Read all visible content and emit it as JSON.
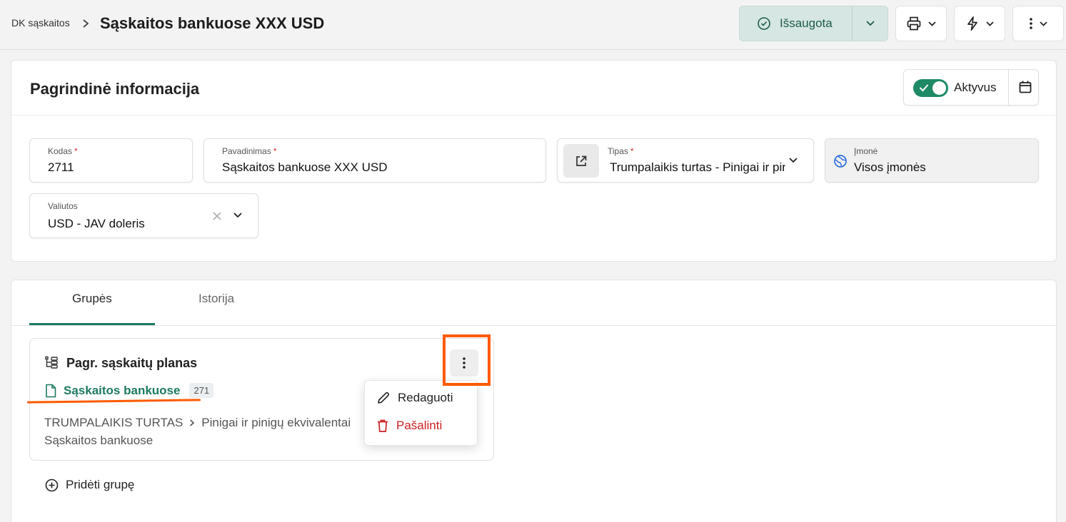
{
  "header": {
    "breadcrumb": "DK sąskaitos",
    "title": "Sąskaitos bankuose XXX USD",
    "saved_label": "Išsaugota"
  },
  "main_info": {
    "title": "Pagrindinė informacija",
    "active_label": "Aktyvus",
    "active": true,
    "fields": {
      "code": {
        "label": "Kodas",
        "value": "2711"
      },
      "name": {
        "label": "Pavadinimas",
        "value": "Sąskaitos bankuose XXX USD"
      },
      "type": {
        "label": "Tipas",
        "value": "Trumpalaikis turtas - Pinigai ir pinigų ekvivalentai"
      },
      "company": {
        "label": "Įmonė",
        "value": "Visos įmonės"
      },
      "currency": {
        "label": "Valiutos",
        "value": "USD - JAV doleris"
      }
    }
  },
  "tabs": [
    {
      "label": "Grupės",
      "active": true
    },
    {
      "label": "Istorija",
      "active": false
    }
  ],
  "group": {
    "title": "Pagr. sąskaitų planas",
    "link_text": "Sąskaitos bankuose",
    "badge": "271",
    "path_part1": "TRUMPALAIKIS TURTAS",
    "path_part2": "Pinigai ir pinigų ekvivalentai",
    "path_part3": "Sąskaitos bankuose"
  },
  "menu": {
    "edit": "Redaguoti",
    "delete": "Pašalinti"
  },
  "add_group_label": "Pridėti grupę",
  "colors": {
    "accent": "#1d7a60",
    "danger": "#cc1f1f",
    "annotation": "#ff5a00"
  }
}
